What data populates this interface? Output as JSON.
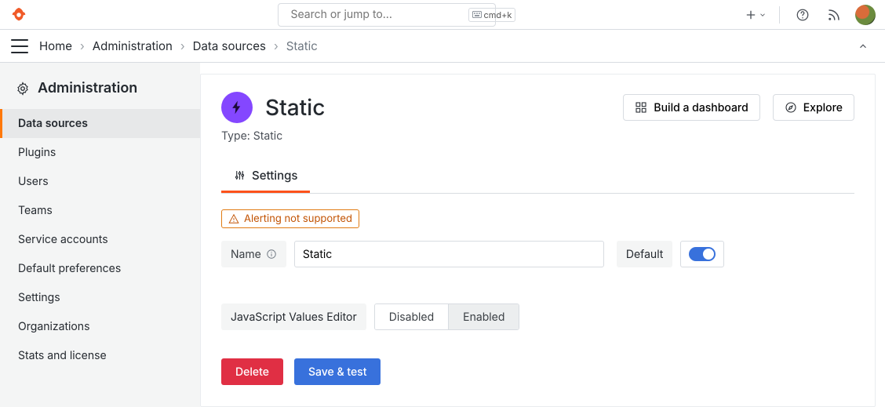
{
  "search": {
    "placeholder": "Search or jump to...",
    "shortcut": "cmd+k"
  },
  "breadcrumbs": {
    "home": "Home",
    "admin": "Administration",
    "ds": "Data sources",
    "current": "Static"
  },
  "sidebar": {
    "title": "Administration",
    "items": [
      "Data sources",
      "Plugins",
      "Users",
      "Teams",
      "Service accounts",
      "Default preferences",
      "Settings",
      "Organizations",
      "Stats and license"
    ]
  },
  "page": {
    "title": "Static",
    "type_line": "Type: Static",
    "build_btn": "Build a dashboard",
    "explore_btn": "Explore"
  },
  "tabs": {
    "settings": "Settings"
  },
  "alert": "Alerting not supported",
  "name_field": {
    "label": "Name",
    "value": "Static"
  },
  "default_field": {
    "label": "Default",
    "on": true
  },
  "js_editor": {
    "label": "JavaScript Values Editor",
    "disabled": "Disabled",
    "enabled": "Enabled",
    "value": "Enabled"
  },
  "buttons": {
    "delete": "Delete",
    "save": "Save & test"
  }
}
